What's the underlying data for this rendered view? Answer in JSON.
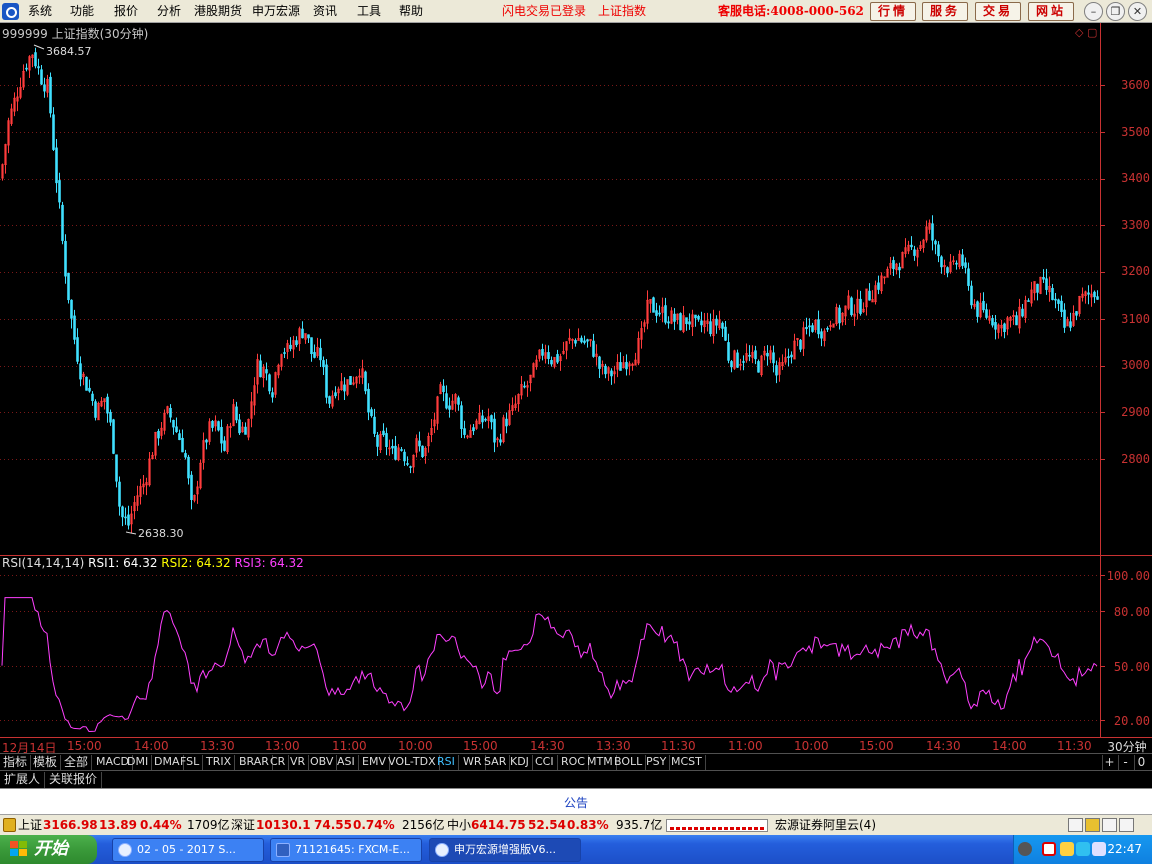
{
  "menu": {
    "items": [
      "系统",
      "功能",
      "报价",
      "分析",
      "港股期货",
      "申万宏源",
      "资讯",
      "工具",
      "帮助"
    ],
    "flash_status": "闪电交易已登录",
    "flash_index": "上证指数",
    "hotline": "客服电话:4008-000-562",
    "tabs": [
      "行情",
      "服务",
      "交易",
      "网站"
    ]
  },
  "chart": {
    "title": "999999 上证指数(30分钟)",
    "high_label": "3684.57",
    "low_label": "2638.30",
    "corner": "◇ ▢",
    "price_ticks": [
      "3600",
      "3500",
      "3400",
      "3300",
      "3200",
      "3100",
      "3000",
      "2900",
      "2800"
    ],
    "rsi_ticks": [
      "100.00",
      "80.00",
      "50.00",
      "20.00"
    ]
  },
  "rsi": {
    "name": "RSI(14,14,14)",
    "rsi1_label": "RSI1: 64.32",
    "rsi2_label": "RSI2: 64.32",
    "rsi3_label": "RSI3: 64.32"
  },
  "colors": {
    "up": "#ff3c3c",
    "down": "#40e0ff",
    "rsi1": "#ffffff",
    "rsi2": "#ffff00",
    "rsi3": "#ff40ff",
    "axis": "#c83232"
  },
  "chart_data": {
    "type": "line",
    "title": "999999 上证指数(30分钟)",
    "series": [
      {
        "x_index": [
          0,
          8,
          16,
          24,
          32,
          40,
          48,
          56,
          64,
          72,
          80,
          88,
          96,
          104,
          112,
          120,
          128,
          136,
          144,
          152,
          160,
          168,
          176,
          184,
          192,
          200,
          208,
          216,
          224,
          232,
          240,
          248,
          256,
          264,
          272,
          280,
          288,
          296,
          304,
          312,
          320,
          328,
          336,
          344,
          352,
          360,
          368,
          376,
          384,
          392,
          400,
          408,
          416,
          424,
          432,
          440,
          448,
          456,
          464,
          472,
          480,
          488,
          496,
          504,
          512,
          520,
          528,
          536,
          544,
          552,
          560,
          568,
          576,
          584,
          592,
          600,
          608,
          616,
          624,
          632,
          640,
          648,
          656,
          664,
          672,
          680,
          688,
          696,
          704,
          712,
          720,
          728,
          736,
          744,
          752,
          760,
          768,
          776,
          784,
          792,
          800,
          808,
          816,
          824,
          832,
          840,
          848,
          856,
          864,
          872,
          880,
          888,
          896,
          904,
          912,
          920,
          928,
          936,
          944,
          952,
          960,
          968,
          976,
          984,
          992,
          1000,
          1008,
          1016,
          1024,
          1032,
          1040,
          1048,
          1056,
          1064,
          1072,
          1080,
          1088,
          1096
        ],
        "values": [
          3400,
          3520,
          3580,
          3640,
          3670,
          3620,
          3590,
          3400,
          3220,
          3080,
          2990,
          2950,
          2900,
          2930,
          2850,
          2680,
          2660,
          2720,
          2750,
          2820,
          2870,
          2900,
          2860,
          2820,
          2680,
          2800,
          2860,
          2870,
          2820,
          2910,
          2860,
          2880,
          3000,
          2990,
          2950,
          3040,
          3030,
          3060,
          3080,
          3020,
          3020,
          2920,
          2960,
          2960,
          2970,
          3000,
          2900,
          2830,
          2840,
          2810,
          2830,
          2790,
          2830,
          2810,
          2870,
          2940,
          2920,
          2930,
          2850,
          2870,
          2880,
          2890,
          2830,
          2880,
          2900,
          2940,
          2960,
          3000,
          3040,
          3010,
          3020,
          3050,
          3060,
          3050,
          3040,
          2990,
          2980,
          2990,
          3010,
          3020,
          3050,
          3130,
          3120,
          3110,
          3100,
          3090,
          3100,
          3080,
          3090,
          3080,
          3100,
          3020,
          3010,
          3020,
          3010,
          3000,
          3040,
          2980,
          3000,
          3040,
          3050,
          3080,
          3090,
          3070,
          3110,
          3100,
          3130,
          3120,
          3140,
          3160,
          3180,
          3200,
          3220,
          3230,
          3250,
          3260,
          3300,
          3240,
          3220,
          3200,
          3240,
          3160,
          3120,
          3110,
          3100,
          3080,
          3100,
          3090,
          3130,
          3160,
          3170,
          3160,
          3130,
          3080,
          3100,
          3140,
          3150,
          3160
        ]
      }
    ],
    "ylim": [
      2600,
      3700
    ]
  },
  "time_axis": {
    "labels": [
      "12月14日",
      "15:00",
      "14:00",
      "13:30",
      "13:00",
      "11:00",
      "10:00",
      "15:00",
      "14:30",
      "13:30",
      "11:30",
      "11:00",
      "10:00",
      "15:00",
      "14:30",
      "14:00",
      "11:30"
    ],
    "timeframe": "30分钟"
  },
  "indicators": {
    "left_tabs": [
      "指标",
      "模板",
      "全部"
    ],
    "tabs": [
      "MACD",
      "DMI",
      "DMA",
      "FSL",
      "TRIX",
      "BRAR",
      "CR",
      "VR",
      "OBV",
      "ASI",
      "EMV",
      "VOL-TDX",
      "RSI",
      "WR",
      "SAR",
      "KDJ",
      "CCI",
      "ROC",
      "MTM",
      "BOLL",
      "PSY",
      "MCST"
    ],
    "active": "RSI",
    "side": [
      "+",
      "-",
      "0"
    ]
  },
  "ext_tabs": [
    "扩展人",
    "关联报价"
  ],
  "notice": "公告",
  "status": {
    "sh_name": "上证",
    "sh_value": "3166.98",
    "sh_change": "13.89",
    "sh_pct": "0.44%",
    "sh_amount": "1709亿",
    "sz_name": "深证",
    "sz_value": "10130.1",
    "sz_change": "74.55",
    "sz_pct": "0.74%",
    "sz_amount": "2156亿",
    "zx_name": "中小",
    "zx_value": "6414.75",
    "zx_change": "52.54",
    "zx_pct": "0.83%",
    "zx_amount": "935.7亿",
    "broker": "宏源证券阿里云(4)"
  },
  "taskbar": {
    "start": "开始",
    "tasks": [
      "02 - 05 - 2017 S...",
      "71121645: FXCM-E...",
      "申万宏源增强版V6..."
    ],
    "clock": "22:47"
  }
}
